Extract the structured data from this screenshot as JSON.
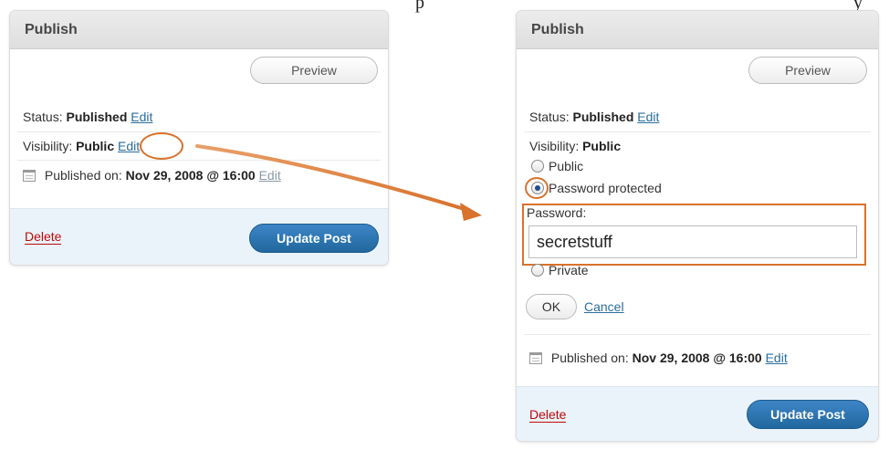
{
  "caption": {
    "fragment": "p",
    "fragment_tail": "y"
  },
  "left_panel": {
    "title": "Publish",
    "preview_label": "Preview",
    "status_label": "Status:",
    "status_value": "Published",
    "status_edit": "Edit",
    "visibility_label": "Visibility:",
    "visibility_value": "Public",
    "visibility_edit": "Edit",
    "published_label": "Published on:",
    "published_value": "Nov 29, 2008 @ 16:00",
    "published_edit": "Edit",
    "delete_label": "Delete",
    "update_label": "Update Post"
  },
  "right_panel": {
    "title": "Publish",
    "preview_label": "Preview",
    "status_label": "Status:",
    "status_value": "Published",
    "status_edit": "Edit",
    "visibility_label": "Visibility:",
    "visibility_value": "Public",
    "options": [
      {
        "label": "Public",
        "checked": false
      },
      {
        "label": "Password protected",
        "checked": true
      },
      {
        "label": "Private",
        "checked": false
      }
    ],
    "password_label": "Password:",
    "password_value": "secretstuff",
    "ok_label": "OK",
    "cancel_label": "Cancel",
    "published_label": "Published on:",
    "published_value": "Nov 29, 2008 @ 16:00",
    "published_edit": "Edit",
    "delete_label": "Delete",
    "update_label": "Update Post"
  },
  "colors": {
    "highlight": "#d9722c",
    "link": "#2a6d9c",
    "delete": "#bc0b0b",
    "primary_button": "#21689f"
  }
}
